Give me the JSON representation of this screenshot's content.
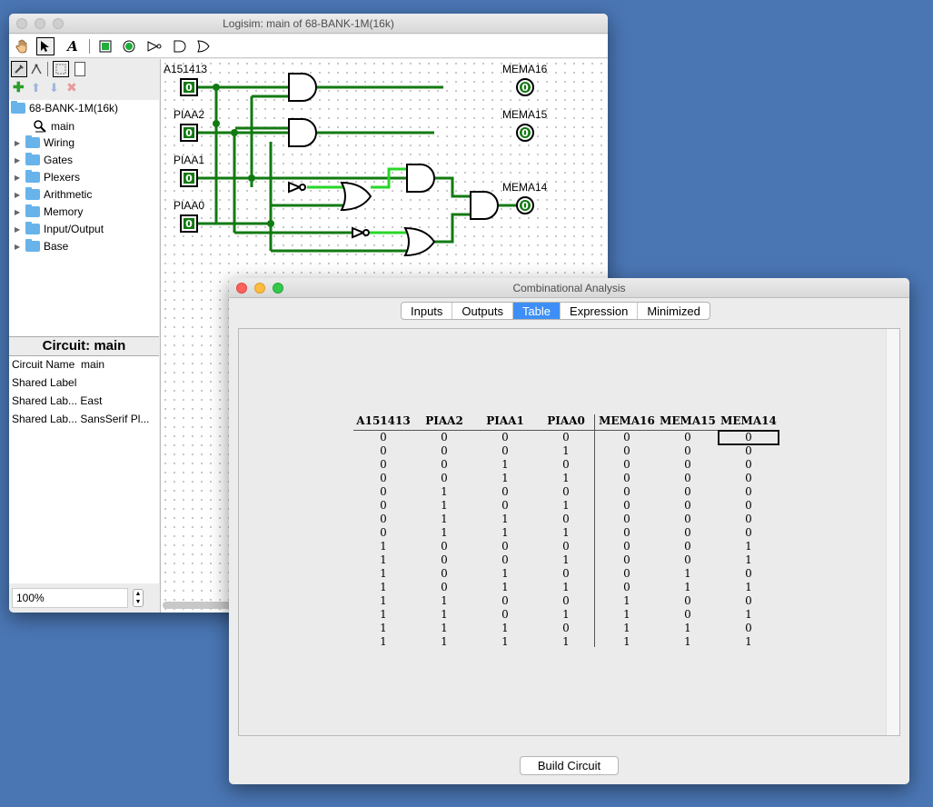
{
  "logisim": {
    "title": "Logisim: main of 68-BANK-1M(16k)",
    "tree": {
      "root": "68-BANK-1M(16k)",
      "main": "main",
      "folders": [
        "Wiring",
        "Gates",
        "Plexers",
        "Arithmetic",
        "Memory",
        "Input/Output",
        "Base"
      ]
    },
    "attributes": {
      "header": "Circuit: main",
      "rows": [
        {
          "name": "Circuit Name",
          "value": "main"
        },
        {
          "name": "Shared Label",
          "value": ""
        },
        {
          "name": "Shared Lab...",
          "value": "East"
        },
        {
          "name": "Shared Lab...",
          "value": "SansSerif Pl..."
        }
      ]
    },
    "zoom": "100%",
    "circuit": {
      "inputs": [
        "A151413",
        "PIAA2",
        "PIAA1",
        "PIAA0"
      ],
      "outputs": [
        "MEMA16",
        "MEMA15",
        "MEMA14"
      ],
      "pin_value": "0"
    }
  },
  "analysis": {
    "title": "Combinational Analysis",
    "tabs": [
      "Inputs",
      "Outputs",
      "Table",
      "Expression",
      "Minimized"
    ],
    "active_tab": "Table",
    "headers": [
      "A151413",
      "PIAA2",
      "PIAA1",
      "PIAA0",
      "MEMA16",
      "MEMA15",
      "MEMA14"
    ],
    "rows": [
      [
        "0",
        "0",
        "0",
        "0",
        "0",
        "0",
        "0"
      ],
      [
        "0",
        "0",
        "0",
        "1",
        "0",
        "0",
        "0"
      ],
      [
        "0",
        "0",
        "1",
        "0",
        "0",
        "0",
        "0"
      ],
      [
        "0",
        "0",
        "1",
        "1",
        "0",
        "0",
        "0"
      ],
      [
        "0",
        "1",
        "0",
        "0",
        "0",
        "0",
        "0"
      ],
      [
        "0",
        "1",
        "0",
        "1",
        "0",
        "0",
        "0"
      ],
      [
        "0",
        "1",
        "1",
        "0",
        "0",
        "0",
        "0"
      ],
      [
        "0",
        "1",
        "1",
        "1",
        "0",
        "0",
        "0"
      ],
      [
        "1",
        "0",
        "0",
        "0",
        "0",
        "0",
        "1"
      ],
      [
        "1",
        "0",
        "0",
        "1",
        "0",
        "0",
        "1"
      ],
      [
        "1",
        "0",
        "1",
        "0",
        "0",
        "1",
        "0"
      ],
      [
        "1",
        "0",
        "1",
        "1",
        "0",
        "1",
        "1"
      ],
      [
        "1",
        "1",
        "0",
        "0",
        "1",
        "0",
        "0"
      ],
      [
        "1",
        "1",
        "0",
        "1",
        "1",
        "0",
        "1"
      ],
      [
        "1",
        "1",
        "1",
        "0",
        "1",
        "1",
        "0"
      ],
      [
        "1",
        "1",
        "1",
        "1",
        "1",
        "1",
        "1"
      ]
    ],
    "button": "Build Circuit"
  }
}
